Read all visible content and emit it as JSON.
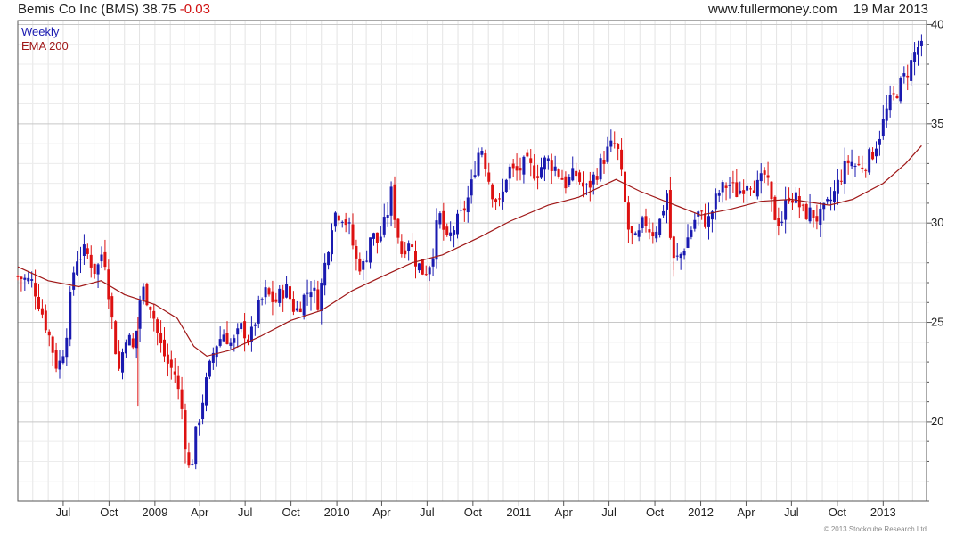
{
  "header": {
    "title": "Bemis Co Inc (BMS)",
    "price": "38.75",
    "change": "-0.03",
    "website": "www.fullermoney.com",
    "date": "19 Mar 2013"
  },
  "legend": {
    "weekly": "Weekly",
    "ema": "EMA 200"
  },
  "copyright": "© 2013 Stockcube Research Ltd",
  "colors": {
    "up": "#1a1ab0",
    "down": "#dd1111",
    "ema": "#a01818",
    "grid": "#cccccc",
    "frame": "#555555"
  },
  "chart_data": {
    "type": "candlestick",
    "interval": "weekly",
    "y_axis": {
      "min": 16,
      "max": 40.2,
      "ticks": [
        20,
        25,
        30,
        35,
        40
      ],
      "side": "right"
    },
    "x_axis": {
      "ticks": [
        {
          "label": "Jul",
          "date": "2008-07-01"
        },
        {
          "label": "Oct",
          "date": "2008-10-01"
        },
        {
          "label": "2009",
          "date": "2009-01-01"
        },
        {
          "label": "Apr",
          "date": "2009-04-01"
        },
        {
          "label": "Jul",
          "date": "2009-07-01"
        },
        {
          "label": "Oct",
          "date": "2009-10-01"
        },
        {
          "label": "2010",
          "date": "2010-01-01"
        },
        {
          "label": "Apr",
          "date": "2010-04-01"
        },
        {
          "label": "Jul",
          "date": "2010-07-01"
        },
        {
          "label": "Oct",
          "date": "2010-10-01"
        },
        {
          "label": "2011",
          "date": "2011-01-01"
        },
        {
          "label": "Apr",
          "date": "2011-04-01"
        },
        {
          "label": "Jul",
          "date": "2011-07-01"
        },
        {
          "label": "Oct",
          "date": "2011-10-01"
        },
        {
          "label": "2012",
          "date": "2012-01-01"
        },
        {
          "label": "Apr",
          "date": "2012-04-01"
        },
        {
          "label": "Jul",
          "date": "2012-07-01"
        },
        {
          "label": "Oct",
          "date": "2012-10-01"
        },
        {
          "label": "2013",
          "date": "2013-01-01"
        }
      ],
      "range": [
        "2008-04-01",
        "2013-03-29"
      ]
    },
    "price_path": [
      {
        "date": "2008-04-01",
        "close": 27.3
      },
      {
        "date": "2008-05-01",
        "close": 27.0
      },
      {
        "date": "2008-06-01",
        "close": 24.5
      },
      {
        "date": "2008-06-20",
        "close": 22.6
      },
      {
        "date": "2008-07-05",
        "close": 24.0
      },
      {
        "date": "2008-07-25",
        "close": 28.2
      },
      {
        "date": "2008-08-15",
        "close": 28.6
      },
      {
        "date": "2008-09-05",
        "close": 27.5
      },
      {
        "date": "2008-09-20",
        "close": 28.8
      },
      {
        "date": "2008-10-05",
        "close": 25.5
      },
      {
        "date": "2008-10-20",
        "close": 22.5
      },
      {
        "date": "2008-11-05",
        "close": 24.5
      },
      {
        "date": "2008-11-20",
        "close": 23.5
      },
      {
        "date": "2008-12-05",
        "close": 26.8
      },
      {
        "date": "2008-12-25",
        "close": 25.8
      },
      {
        "date": "2009-01-10",
        "close": 24.0
      },
      {
        "date": "2009-01-25",
        "close": 23.0
      },
      {
        "date": "2009-02-10",
        "close": 22.4
      },
      {
        "date": "2009-02-25",
        "close": 20.5
      },
      {
        "date": "2009-03-05",
        "close": 18.5
      },
      {
        "date": "2009-03-12",
        "close": 17.3
      },
      {
        "date": "2009-03-25",
        "close": 19.5
      },
      {
        "date": "2009-04-10",
        "close": 21.5
      },
      {
        "date": "2009-05-01",
        "close": 23.8
      },
      {
        "date": "2009-05-20",
        "close": 24.5
      },
      {
        "date": "2009-06-05",
        "close": 23.8
      },
      {
        "date": "2009-06-25",
        "close": 24.8
      },
      {
        "date": "2009-07-10",
        "close": 24.0
      },
      {
        "date": "2009-07-25",
        "close": 25.5
      },
      {
        "date": "2009-08-10",
        "close": 26.5
      },
      {
        "date": "2009-08-30",
        "close": 26.0
      },
      {
        "date": "2009-09-20",
        "close": 26.8
      },
      {
        "date": "2009-10-10",
        "close": 25.5
      },
      {
        "date": "2009-10-25",
        "close": 26.2
      },
      {
        "date": "2009-11-10",
        "close": 26.8
      },
      {
        "date": "2009-11-25",
        "close": 26.0
      },
      {
        "date": "2009-12-10",
        "close": 28.2
      },
      {
        "date": "2009-12-25",
        "close": 30.5
      },
      {
        "date": "2010-01-10",
        "close": 30.5
      },
      {
        "date": "2010-01-25",
        "close": 29.8
      },
      {
        "date": "2010-02-10",
        "close": 28.0
      },
      {
        "date": "2010-02-25",
        "close": 27.8
      },
      {
        "date": "2010-03-10",
        "close": 29.5
      },
      {
        "date": "2010-03-25",
        "close": 29.0
      },
      {
        "date": "2010-04-10",
        "close": 30.2
      },
      {
        "date": "2010-04-20",
        "close": 31.5
      },
      {
        "date": "2010-04-30",
        "close": 30.0
      },
      {
        "date": "2010-05-10",
        "close": 28.5
      },
      {
        "date": "2010-05-25",
        "close": 29.2
      },
      {
        "date": "2010-06-10",
        "close": 28.0
      },
      {
        "date": "2010-06-25",
        "close": 27.5
      },
      {
        "date": "2010-07-10",
        "close": 28.2
      },
      {
        "date": "2010-07-25",
        "close": 30.5
      },
      {
        "date": "2010-08-10",
        "close": 29.0
      },
      {
        "date": "2010-08-25",
        "close": 29.8
      },
      {
        "date": "2010-09-10",
        "close": 30.5
      },
      {
        "date": "2010-09-25",
        "close": 31.5
      },
      {
        "date": "2010-10-10",
        "close": 33.5
      },
      {
        "date": "2010-10-20",
        "close": 33.8
      },
      {
        "date": "2010-10-30",
        "close": 32.5
      },
      {
        "date": "2010-11-10",
        "close": 31.5
      },
      {
        "date": "2010-11-25",
        "close": 30.8
      },
      {
        "date": "2010-12-10",
        "close": 32.8
      },
      {
        "date": "2010-12-25",
        "close": 32.5
      },
      {
        "date": "2011-01-15",
        "close": 33.0
      },
      {
        "date": "2011-02-05",
        "close": 32.5
      },
      {
        "date": "2011-02-25",
        "close": 33.2
      },
      {
        "date": "2011-03-15",
        "close": 32.8
      },
      {
        "date": "2011-04-05",
        "close": 32.0
      },
      {
        "date": "2011-04-25",
        "close": 32.5
      },
      {
        "date": "2011-05-15",
        "close": 31.6
      },
      {
        "date": "2011-06-05",
        "close": 32.5
      },
      {
        "date": "2011-06-25",
        "close": 33.5
      },
      {
        "date": "2011-07-10",
        "close": 34.0
      },
      {
        "date": "2011-07-20",
        "close": 33.5
      },
      {
        "date": "2011-07-30",
        "close": 31.5
      },
      {
        "date": "2011-08-10",
        "close": 29.5
      },
      {
        "date": "2011-08-25",
        "close": 29.0
      },
      {
        "date": "2011-09-10",
        "close": 30.2
      },
      {
        "date": "2011-09-25",
        "close": 29.5
      },
      {
        "date": "2011-10-10",
        "close": 30.0
      },
      {
        "date": "2011-10-25",
        "close": 31.5
      },
      {
        "date": "2011-11-05",
        "close": 28.0
      },
      {
        "date": "2011-11-20",
        "close": 28.3
      },
      {
        "date": "2011-12-05",
        "close": 29.2
      },
      {
        "date": "2011-12-25",
        "close": 30.5
      },
      {
        "date": "2012-01-15",
        "close": 30.0
      },
      {
        "date": "2012-02-05",
        "close": 31.5
      },
      {
        "date": "2012-02-25",
        "close": 32.0
      },
      {
        "date": "2012-03-15",
        "close": 31.5
      },
      {
        "date": "2012-04-05",
        "close": 32.2
      },
      {
        "date": "2012-04-25",
        "close": 31.8
      },
      {
        "date": "2012-05-10",
        "close": 32.5
      },
      {
        "date": "2012-05-25",
        "close": 30.5
      },
      {
        "date": "2012-06-10",
        "close": 30.0
      },
      {
        "date": "2012-06-25",
        "close": 31.5
      },
      {
        "date": "2012-07-10",
        "close": 31.2
      },
      {
        "date": "2012-07-25",
        "close": 30.5
      },
      {
        "date": "2012-08-10",
        "close": 30.5
      },
      {
        "date": "2012-08-25",
        "close": 30.2
      },
      {
        "date": "2012-09-10",
        "close": 30.8
      },
      {
        "date": "2012-09-25",
        "close": 31.5
      },
      {
        "date": "2012-10-10",
        "close": 32.5
      },
      {
        "date": "2012-10-25",
        "close": 33.2
      },
      {
        "date": "2012-11-10",
        "close": 32.8
      },
      {
        "date": "2012-11-25",
        "close": 33.0
      },
      {
        "date": "2012-12-10",
        "close": 33.5
      },
      {
        "date": "2012-12-25",
        "close": 34.5
      },
      {
        "date": "2013-01-10",
        "close": 35.8
      },
      {
        "date": "2013-01-25",
        "close": 36.5
      },
      {
        "date": "2013-02-10",
        "close": 37.2
      },
      {
        "date": "2013-02-25",
        "close": 38.0
      },
      {
        "date": "2013-03-10",
        "close": 38.9
      },
      {
        "date": "2013-03-19",
        "close": 38.75
      }
    ],
    "ema_200": [
      {
        "date": "2008-04-01",
        "value": 27.8
      },
      {
        "date": "2008-06-01",
        "value": 27.1
      },
      {
        "date": "2008-08-01",
        "value": 26.8
      },
      {
        "date": "2008-09-15",
        "value": 27.1
      },
      {
        "date": "2008-11-01",
        "value": 26.4
      },
      {
        "date": "2009-01-01",
        "value": 25.9
      },
      {
        "date": "2009-02-15",
        "value": 25.2
      },
      {
        "date": "2009-03-20",
        "value": 23.8
      },
      {
        "date": "2009-04-15",
        "value": 23.3
      },
      {
        "date": "2009-06-01",
        "value": 23.6
      },
      {
        "date": "2009-08-01",
        "value": 24.3
      },
      {
        "date": "2009-10-01",
        "value": 25.1
      },
      {
        "date": "2009-12-01",
        "value": 25.6
      },
      {
        "date": "2010-02-01",
        "value": 26.6
      },
      {
        "date": "2010-04-01",
        "value": 27.3
      },
      {
        "date": "2010-06-01",
        "value": 28.0
      },
      {
        "date": "2010-08-01",
        "value": 28.4
      },
      {
        "date": "2010-10-15",
        "value": 29.3
      },
      {
        "date": "2010-12-15",
        "value": 30.1
      },
      {
        "date": "2011-03-01",
        "value": 30.9
      },
      {
        "date": "2011-05-01",
        "value": 31.3
      },
      {
        "date": "2011-07-15",
        "value": 32.2
      },
      {
        "date": "2011-09-01",
        "value": 31.6
      },
      {
        "date": "2011-11-01",
        "value": 31.0
      },
      {
        "date": "2012-01-01",
        "value": 30.4
      },
      {
        "date": "2012-03-01",
        "value": 30.7
      },
      {
        "date": "2012-05-01",
        "value": 31.1
      },
      {
        "date": "2012-07-01",
        "value": 31.2
      },
      {
        "date": "2012-09-15",
        "value": 30.9
      },
      {
        "date": "2012-11-01",
        "value": 31.2
      },
      {
        "date": "2013-01-01",
        "value": 32.0
      },
      {
        "date": "2013-02-15",
        "value": 33.0
      },
      {
        "date": "2013-03-19",
        "value": 33.9
      }
    ],
    "extreme_spikes": [
      {
        "date": "2010-07-05",
        "low": 25.6
      },
      {
        "date": "2008-11-28",
        "low": 20.8
      },
      {
        "date": "2011-11-08",
        "low": 27.3
      }
    ],
    "grid": true
  }
}
